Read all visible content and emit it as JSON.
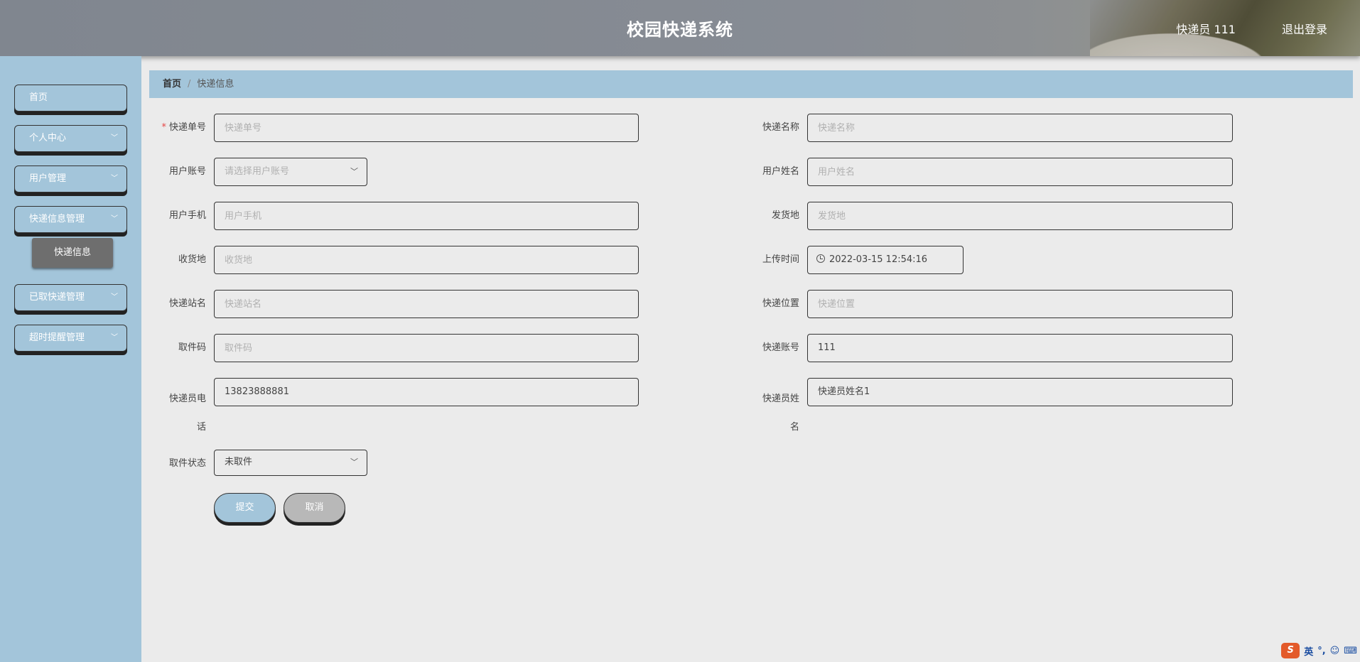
{
  "header": {
    "title": "校园快递系统",
    "user": "快递员 111",
    "logout": "退出登录"
  },
  "sidebar": {
    "items": [
      {
        "label": "首页"
      },
      {
        "label": "个人中心"
      },
      {
        "label": "用户管理"
      },
      {
        "label": "快递信息管理"
      },
      {
        "label": "已取快递管理"
      },
      {
        "label": "超时提醒管理"
      }
    ],
    "submenu_active": "快递信息"
  },
  "breadcrumb": {
    "home": "首页",
    "separator": "/",
    "current": "快递信息"
  },
  "form": {
    "tracking_no": {
      "label": "快递单号",
      "placeholder": "快递单号",
      "value": ""
    },
    "courier_name": {
      "label": "快递名称",
      "placeholder": "快递名称",
      "value": ""
    },
    "user_account": {
      "label": "用户账号",
      "placeholder": "请选择用户账号"
    },
    "user_name": {
      "label": "用户姓名",
      "placeholder": "用户姓名",
      "value": ""
    },
    "user_phone": {
      "label": "用户手机",
      "placeholder": "用户手机",
      "value": ""
    },
    "origin": {
      "label": "发货地",
      "placeholder": "发货地",
      "value": ""
    },
    "destination": {
      "label": "收货地",
      "placeholder": "收货地",
      "value": ""
    },
    "upload_time": {
      "label": "上传时间",
      "value": "2022-03-15 12:54:16"
    },
    "station_name": {
      "label": "快递站名",
      "placeholder": "快递站名",
      "value": ""
    },
    "location": {
      "label": "快递位置",
      "placeholder": "快递位置",
      "value": ""
    },
    "pickup_code": {
      "label": "取件码",
      "placeholder": "取件码",
      "value": ""
    },
    "courier_account": {
      "label": "快递账号",
      "value": "111"
    },
    "courier_phone": {
      "label_line1": "快递员电",
      "label_line2": "话",
      "value": "13823888881"
    },
    "courier_person": {
      "label_line1": "快递员姓",
      "label_line2": "名",
      "value": "快递员姓名1"
    },
    "pickup_status": {
      "label": "取件状态",
      "value": "未取件"
    },
    "submit": "提交",
    "cancel": "取消"
  },
  "ime": {
    "brand": "S",
    "lang": "英",
    "punct": "°,"
  },
  "icons": {
    "chevron": "chevron-down-icon",
    "clock": "clock-icon"
  }
}
